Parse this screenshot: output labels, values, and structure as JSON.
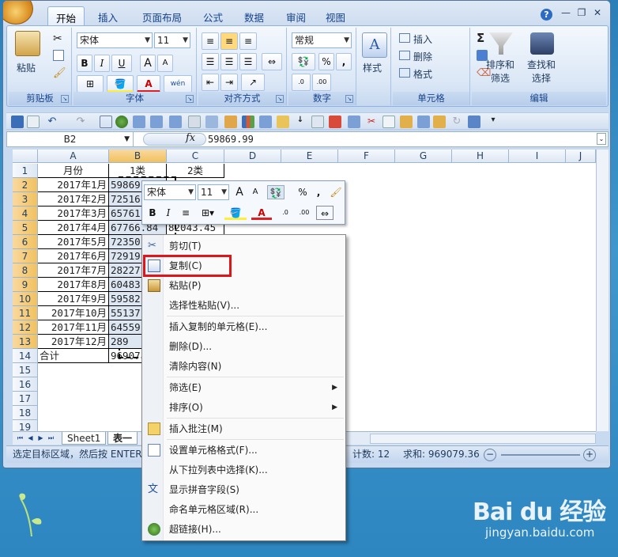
{
  "ribbon": {
    "tabs": [
      "开始",
      "插入",
      "页面布局",
      "公式",
      "数据",
      "审阅",
      "视图"
    ],
    "active_tab": "开始",
    "clipboard": {
      "paste": "粘贴",
      "label": "剪贴板"
    },
    "font": {
      "name": "宋体",
      "size": "11",
      "label": "字体",
      "bold": "B",
      "italic": "I",
      "underline": "U",
      "grow": "A",
      "shrink": "A",
      "color_a": "A",
      "phonetic": "wén"
    },
    "alignment": {
      "label": "对齐方式"
    },
    "number": {
      "format": "常规",
      "label": "数字",
      "percent": "%",
      "comma": ","
    },
    "styles": {
      "label": "样式"
    },
    "cells": {
      "insert": "插入",
      "delete": "删除",
      "format": "格式",
      "label": "单元格"
    },
    "editing": {
      "sigma": "Σ",
      "sort": "排序和\n筛选",
      "find": "查找和\n选择",
      "label": "编辑"
    }
  },
  "formula_bar": {
    "name_box": "B2",
    "fx": "fx",
    "value": "59869.99"
  },
  "grid": {
    "columns": [
      "A",
      "B",
      "C",
      "D",
      "E",
      "F",
      "G",
      "H",
      "I",
      "J"
    ],
    "rows": [
      "1",
      "2",
      "3",
      "4",
      "5",
      "6",
      "7",
      "8",
      "9",
      "10",
      "11",
      "12",
      "13",
      "14",
      "15",
      "16",
      "17",
      "18",
      "19"
    ],
    "header_row": {
      "a": "月份",
      "b": "1类",
      "c": "2类"
    },
    "months": [
      "2017年1月",
      "2017年2月",
      "2017年3月",
      "2017年4月",
      "2017年5月",
      "2017年6月",
      "2017年7月",
      "2017年8月",
      "2017年9月",
      "2017年10月",
      "2017年11月",
      "2017年12月"
    ],
    "b_values": [
      "59869",
      "72516",
      "65761",
      "67766.84",
      "72350",
      "72919",
      "28227",
      "60483",
      "59582",
      "55137",
      "64559",
      "289"
    ],
    "c_values_visible": {
      "row5": "82043.45"
    },
    "total_label": "合计",
    "total_value": "96907"
  },
  "sheets": {
    "tabs": [
      "Sheet1",
      "表一"
    ]
  },
  "status": {
    "message": "选定目标区域，然后按 ENTER",
    "count": "计数: 12",
    "sum": "求和: 969079.36",
    "minus": "−",
    "plus": "+"
  },
  "mini_toolbar": {
    "font": "宋体",
    "size": "11",
    "bold": "B",
    "italic": "I",
    "percent": "%",
    "comma": ",",
    "color_a": "A"
  },
  "context_menu": {
    "items": [
      {
        "label": "剪切(T)",
        "icon": "scissors-icon"
      },
      {
        "label": "复制(C)",
        "icon": "copy-icon"
      },
      {
        "label": "粘贴(P)",
        "icon": "paste-icon"
      },
      {
        "label": "选择性粘贴(V)...",
        "icon": ""
      },
      {
        "label": "插入复制的单元格(E)...",
        "icon": ""
      },
      {
        "label": "删除(D)...",
        "icon": ""
      },
      {
        "label": "清除内容(N)",
        "icon": ""
      },
      {
        "label": "筛选(E)",
        "icon": "",
        "submenu": true
      },
      {
        "label": "排序(O)",
        "icon": "",
        "submenu": true
      },
      {
        "label": "插入批注(M)",
        "icon": "comment-icon"
      },
      {
        "label": "设置单元格格式(F)...",
        "icon": "format-cells-icon"
      },
      {
        "label": "从下拉列表中选择(K)...",
        "icon": ""
      },
      {
        "label": "显示拼音字段(S)",
        "icon": "phonetic-icon"
      },
      {
        "label": "命名单元格区域(R)...",
        "icon": ""
      },
      {
        "label": "超链接(H)...",
        "icon": "hyperlink-icon"
      }
    ],
    "submenu_arrow": "▶"
  },
  "watermark": {
    "logo": "Bai du 经验",
    "url": "jingyan.baidu.com"
  },
  "colors": {
    "highlight": "#e0141b",
    "selection": "#f1c15f",
    "ribbon_text": "#15428b"
  }
}
